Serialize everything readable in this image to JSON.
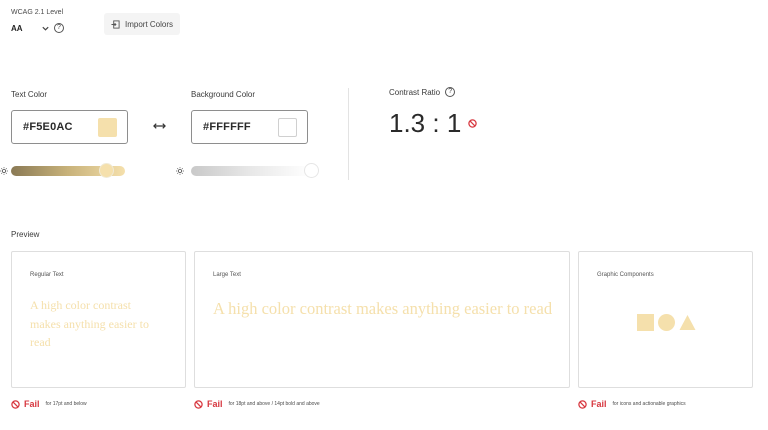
{
  "wcag": {
    "label": "WCAG 2.1 Level",
    "level": "AA",
    "help_icon": "help-icon",
    "chevron_icon": "chevron-down-icon"
  },
  "import": {
    "label": "Import Colors",
    "icon": "import-icon"
  },
  "text_color": {
    "label": "Text Color",
    "hex": "#F5E0AC",
    "swatch": "#F5E0AC",
    "brightness_level": 0.84
  },
  "background_color": {
    "label": "Background Color",
    "hex": "#FFFFFF",
    "swatch": "#FFFFFF",
    "brightness_level": 1.0
  },
  "contrast": {
    "label": "Contrast Ratio",
    "value": "1.3 : 1",
    "status_icon": "no-icon"
  },
  "preview": {
    "label": "Preview",
    "regular": {
      "title": "Regular Text",
      "sample": "A high color contrast makes anything easier to read"
    },
    "large": {
      "title": "Large Text",
      "sample": "A high color contrast makes anything easier to read"
    },
    "graphic": {
      "title": "Graphic Components",
      "shapes": [
        "square",
        "circle",
        "triangle"
      ]
    }
  },
  "results": [
    {
      "status": "Fail",
      "note": "for 17pt and below"
    },
    {
      "status": "Fail",
      "note": "for 18pt and above / 14pt bold and above"
    },
    {
      "status": "Fail",
      "note": "for icons and actionable graphics"
    }
  ],
  "colors": {
    "accent_fail": "#D7373F",
    "sample_color": "#F5E0AC"
  }
}
